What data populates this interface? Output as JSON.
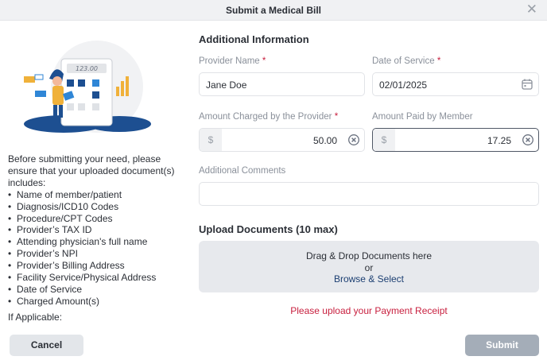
{
  "dialog": {
    "title": "Submit a Medical Bill",
    "close_icon": "close-icon"
  },
  "illustration": {
    "calculator_display": "123.00"
  },
  "instructions": {
    "intro": "Before submitting your need, please ensure that your uploaded document(s) includes:",
    "items": [
      "Name of member/patient",
      "Diagnosis/ICD10 Codes",
      "Procedure/CPT Codes",
      "Provider’s TAX ID",
      "Attending physician's full name",
      "Provider’s NPI",
      "Provider’s Billing Address",
      "Facility Service/Physical Address",
      "Date of Service",
      "Charged Amount(s)"
    ],
    "more": "If Applicable:"
  },
  "form": {
    "section_title": "Additional Information",
    "provider_name": {
      "label": "Provider Name",
      "required": "*",
      "value": "Jane Doe"
    },
    "date_of_service": {
      "label": "Date of Service",
      "required": "*",
      "value": "02/01/2025",
      "icon": "calendar-icon"
    },
    "amount_charged": {
      "label": "Amount Charged by the Provider",
      "required": "*",
      "prefix": "$",
      "value": "50.00",
      "icon": "clear-icon"
    },
    "amount_paid": {
      "label": "Amount Paid by Member",
      "prefix": "$",
      "value": "17.25",
      "icon": "clear-icon"
    },
    "comments": {
      "label": "Additional Comments",
      "value": ""
    }
  },
  "upload": {
    "section_title": "Upload Documents (10 max)",
    "drag_text": "Drag & Drop Documents here",
    "or_text": "or",
    "browse_label": "Browse & Select",
    "warning": "Please upload your Payment Receipt"
  },
  "footer": {
    "cancel_label": "Cancel",
    "submit_label": "Submit"
  },
  "colors": {
    "required": "#c8203f",
    "link": "#1c3f72",
    "submit_disabled": "#a4adb8",
    "illustration_blue": "#1d4f91"
  }
}
